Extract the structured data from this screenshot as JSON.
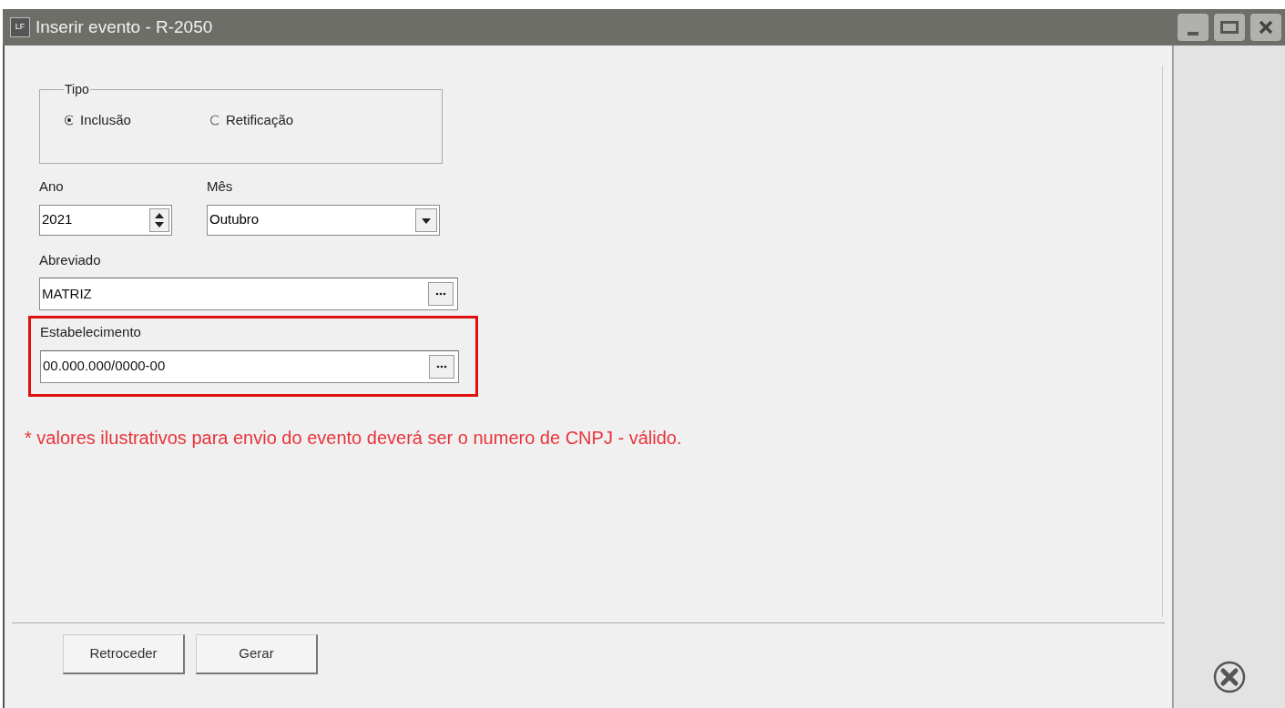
{
  "window": {
    "title": "Inserir evento - R-2050",
    "app_badge": "LF"
  },
  "tipo": {
    "legend": "Tipo",
    "options": [
      {
        "label": "Inclusão",
        "selected": true
      },
      {
        "label": "Retificação",
        "selected": false
      }
    ]
  },
  "ano": {
    "label": "Ano",
    "value": "2021"
  },
  "mes": {
    "label": "Mês",
    "value": "Outubro"
  },
  "abreviado": {
    "label": "Abreviado",
    "value": "MATRIZ"
  },
  "estabelecimento": {
    "label": "Estabelecimento",
    "value": "00.000.000/0000-00",
    "highlighted": true
  },
  "note": "* valores ilustrativos para envio do evento deverá ser o numero de CNPJ - válido.",
  "buttons": [
    "Retroceder",
    "Gerar"
  ]
}
